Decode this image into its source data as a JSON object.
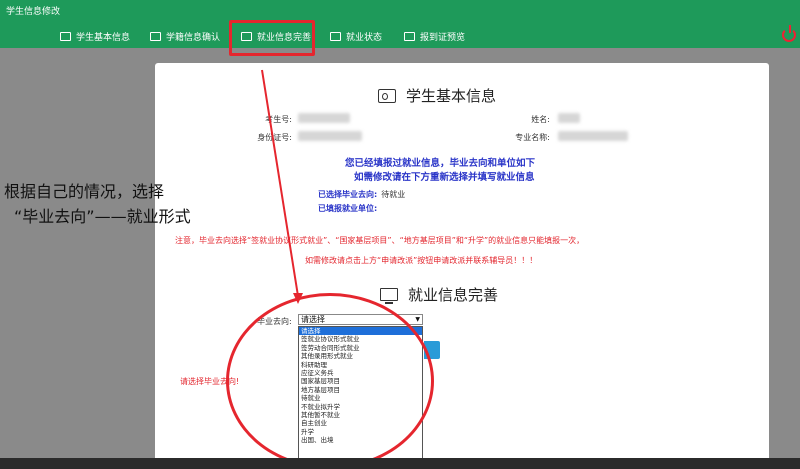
{
  "app": {
    "title": "学生信息修改"
  },
  "nav": {
    "items": [
      {
        "label": "学生基本信息",
        "icon": "id-card-icon"
      },
      {
        "label": "学籍信息确认",
        "icon": "document-icon"
      },
      {
        "label": "就业信息完善",
        "icon": "monitor-icon",
        "active": true
      },
      {
        "label": "就业状态",
        "icon": "monitor-icon"
      },
      {
        "label": "报到证预览",
        "icon": "screen-icon"
      }
    ]
  },
  "basic": {
    "title": "学生基本信息",
    "student_no_label": "考生号:",
    "name_label": "姓名:",
    "id_no_label": "身份证号:",
    "major_label": "专业名称:"
  },
  "notice": {
    "line1": "您已经填报过就业信息，毕业去向和单位如下",
    "line2": "如需修改请在下方重新选择并填写就业信息",
    "chosen_dest_label": "已选择毕业去向:",
    "chosen_dest_value": "待就业",
    "filled_unit_label": "已填报就业单位:",
    "warning1": "注意，毕业去向选择“签就业协议形式就业”、“国家基层项目”、“地方基层项目”和“升学”的就业信息只能填报一次，",
    "warning2": "如需修改请点击上方“申请改派”按钮申请改派并联系辅导员！！！"
  },
  "employment": {
    "title": "就业信息完善",
    "dest_label": "毕业去向:",
    "select_value": "请选择",
    "options": [
      "请选择",
      "签就业协议形式就业",
      "签劳动合同形式就业",
      "其他录用形式就业",
      "科研助理",
      "应征义务兵",
      "国家基层项目",
      "地方基层项目",
      "待就业",
      "不就业拟升学",
      "其他暂不就业",
      "自主创业",
      "升学",
      "出国、出境"
    ],
    "error": "请选择毕业去向!"
  },
  "annotation": {
    "line1": "根据自己的情况，选择",
    "line2": "“毕业去向”——就业形式"
  },
  "colors": {
    "topbar": "#1e9a5a",
    "highlight": "#e5262e",
    "notice": "#2a35c8"
  }
}
